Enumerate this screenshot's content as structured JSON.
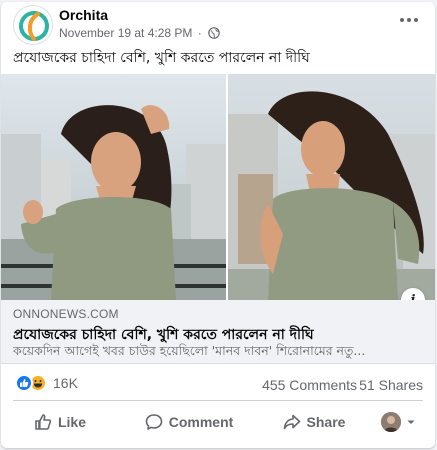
{
  "post": {
    "page_name": "Orchita",
    "timestamp": "November 19 at 4:28 PM",
    "separator": "·",
    "text": "প্রযোজকের চাহিদা বেশি, খুশি করতে পারলেন না দীঘি"
  },
  "link_preview": {
    "domain": "ONNONEWS.COM",
    "title": "প্রযোজকের চাহিদা বেশি, খুশি করতে পারলেন না দীঘি",
    "description": "কয়েকদিন আগেই খবর চাউর হয়েছিলো 'মানব দাবন' শিরোনামের নতু..."
  },
  "stats": {
    "reactions_count": "16K",
    "comments": "455 Comments",
    "shares": "51 Shares"
  },
  "actions": {
    "like": "Like",
    "comment": "Comment",
    "share": "Share"
  },
  "icons": {
    "avatar": "orchita-logo-icon",
    "privacy": "globe-icon",
    "more": "more-options-icon",
    "info": "info-icon",
    "like_reaction": "like-reaction-icon",
    "haha_reaction": "haha-reaction-icon",
    "like_action": "thumbs-up-icon",
    "comment_action": "comment-bubble-icon",
    "share_action": "share-arrow-icon",
    "audience_caret": "caret-down-icon"
  },
  "colors": {
    "brand_teal": "#2bb3a3",
    "brand_orange": "#f39c2a",
    "like_blue": "#1877f2",
    "haha_yellow": "#f7b125",
    "muted_text": "#65676b"
  }
}
